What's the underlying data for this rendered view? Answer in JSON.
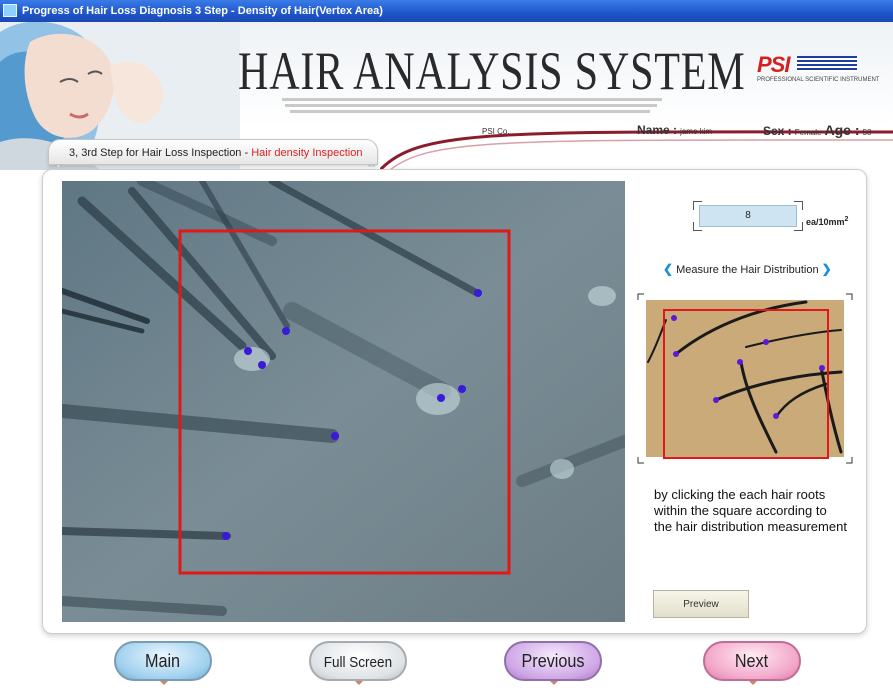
{
  "window": {
    "title": "Progress of Hair Loss Diagnosis 3 Step - Density of Hair(Vertex Area)"
  },
  "header": {
    "brand_title": "HAIR ANALYSIS SYSTEM",
    "logo_text": "PSI",
    "logo_tagline": "PROFESSIONAL SCIENTIFIC INSTRUMENT",
    "company": "PSI Co.",
    "name_label": "Name :",
    "name_value": "jame kim",
    "sex_label": "Sex :",
    "sex_value": "Female",
    "age_label": "Age :",
    "age_value": "58"
  },
  "step_tab": {
    "prefix": "3, 3rd Step for Hair Loss Inspection - ",
    "highlight": "Hair density Inspection"
  },
  "side": {
    "count_value": "8",
    "count_unit": "ea/10mm",
    "count_unit_sup": "2",
    "measure_label": "Measure the Hair Distribution",
    "instructions": [
      "by clicking the each hair roots",
      "within the square according to",
      "the hair distribution measurement"
    ],
    "preview_label": "Preview"
  },
  "nav": {
    "main": "Main",
    "fullscreen": "Full Screen",
    "previous": "Previous",
    "next": "Next"
  },
  "colors": {
    "title_bar": "#1f56c9",
    "highlight_red": "#e02020",
    "roi_red": "#e01818",
    "marker": "#3a1ad8"
  },
  "icons": {
    "measure_left": "chevron-left-icon",
    "measure_right": "chevron-right-icon"
  }
}
